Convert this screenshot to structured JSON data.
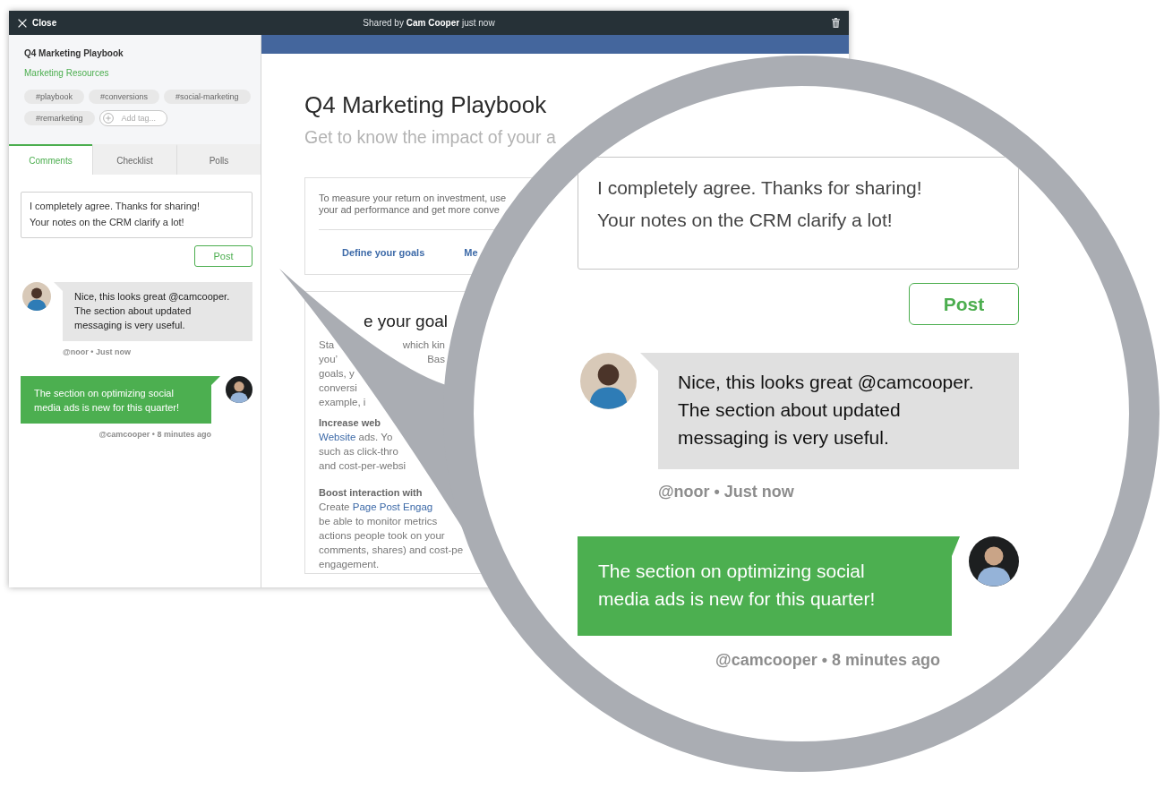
{
  "window": {
    "close_label": "Close",
    "shared_text": "Shared by **Cam Cooper** just now"
  },
  "sidebar": {
    "title": "Q4 Marketing Playbook",
    "category": "Marketing Resources",
    "tags": [
      "#playbook",
      "#conversions",
      "#social-marketing",
      "#remarketing"
    ],
    "add_tag": "Add tag...",
    "tabs": [
      {
        "label": "Comments",
        "selected": true
      },
      {
        "label": "Checklist",
        "selected": false
      },
      {
        "label": "Polls",
        "selected": false
      }
    ],
    "comment_input": {
      "value": "I completely agree. Thanks for sharing! Your notes on the CRM clarify a lot!"
    },
    "post_button": "Post",
    "comments": [
      {
        "kind": "incoming",
        "text": "Nice, this looks great @camcooper. The section about updated messaging is very useful.",
        "meta": "@noor • Just now"
      },
      {
        "kind": "outgoing",
        "text": "The section on optimizing social media ads is new for this quarter!",
        "meta": "@camcooper • 8 minutes ago"
      }
    ]
  },
  "document": {
    "title": "Q4 Marketing Playbook",
    "subtitle": "Get to know the impact of your a",
    "intro_card": {
      "lines": [
        "To measure your return on investment, use",
        "your ad performance and get more conve"
      ],
      "links": [
        "Define your goals",
        "Me"
      ]
    },
    "goals_card": {
      "heading": "e your goal",
      "paragraphs": [
        [
          {
            "kind": "split",
            "text": "Sta",
            "right": "which kin"
          },
          {
            "kind": "split",
            "text": "you’",
            "right": "Bas"
          },
          {
            "kind": "plain",
            "text": "goals, y"
          },
          {
            "kind": "plain",
            "text": "conversi"
          },
          {
            "kind": "plain",
            "text": "example, i"
          }
        ],
        [
          {
            "kind": "bold",
            "text": "Increase web"
          },
          {
            "kind": "linked",
            "link": "Website",
            "after": " ads. Yo"
          },
          {
            "kind": "plain",
            "text": "such as click-thro"
          },
          {
            "kind": "plain",
            "text": "and cost-per-websi"
          }
        ],
        [
          {
            "kind": "bold",
            "text": "Boost interaction with"
          },
          {
            "kind": "linked",
            "before": "Create ",
            "link": "Page Post Engag"
          },
          {
            "kind": "plain",
            "text": "be able to monitor metrics"
          },
          {
            "kind": "plain",
            "text": "actions people took on your"
          },
          {
            "kind": "plain",
            "text": "comments, shares) and cost-pe"
          },
          {
            "kind": "plain",
            "text": "engagement."
          }
        ]
      ]
    }
  },
  "magnifier": {
    "comment_input": {
      "value": "I completely agree. Thanks for sharing! Your notes on the CRM clarify a lot!"
    },
    "post_button": "Post",
    "comments": [
      {
        "kind": "incoming",
        "text": "Nice, this looks great @camcooper. The section about updated messaging is very useful.",
        "meta": "@noor • Just now"
      },
      {
        "kind": "outgoing",
        "text": "The section on optimizing social media ads is new for this quarter!",
        "meta": "@camcooper • 8 minutes ago"
      }
    ]
  }
}
